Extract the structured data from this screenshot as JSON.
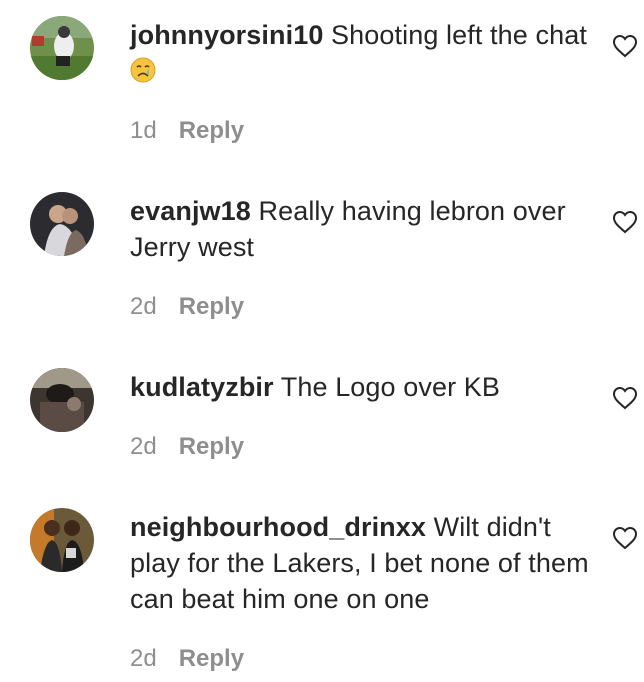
{
  "comments": [
    {
      "username": "johnnyorsini10",
      "text": "Shooting left the chat",
      "emoji": "crying-face",
      "emoji_char": "😢",
      "time": "1d",
      "reply_label": "Reply"
    },
    {
      "username": "evanjw18",
      "text": "Really having lebron over Jerry west",
      "time": "2d",
      "reply_label": "Reply"
    },
    {
      "username": "kudlatyzbir",
      "text": "The Logo over KB",
      "time": "2d",
      "reply_label": "Reply"
    },
    {
      "username": "neighbourhood_drinxx",
      "text": "Wilt didn't play for the Lakers, I bet none of them can beat him one on one",
      "time": "2d",
      "reply_label": "Reply"
    }
  ],
  "icons": {
    "like": "heart-outline-icon"
  },
  "colors": {
    "text": "#262626",
    "secondary": "#8e8e8e"
  }
}
